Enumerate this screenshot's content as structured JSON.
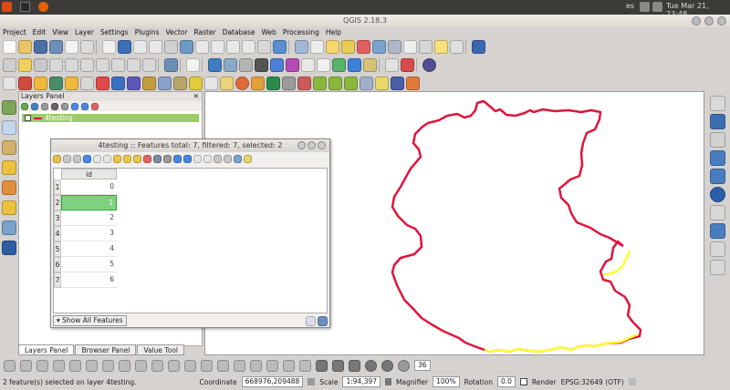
{
  "topbar": {
    "time": "Tue Mar 21, 23:48",
    "lang": "es"
  },
  "window": {
    "title": "QGIS 2.18.3"
  },
  "menu": [
    "Project",
    "Edit",
    "View",
    "Layer",
    "Settings",
    "Plugins",
    "Vector",
    "Raster",
    "Database",
    "Web",
    "Processing",
    "Help"
  ],
  "layers_panel": {
    "title": "Layers Panel",
    "layer_name": "4testing"
  },
  "panel_tabs": [
    "Layers Panel",
    "Browser Panel",
    "Value Tool"
  ],
  "attr_table": {
    "title": "4testing :: Features total: 7, filtered: 7, selected: 2",
    "column": "id",
    "rows": [
      {
        "n": "1",
        "v": "0"
      },
      {
        "n": "2",
        "v": "1"
      },
      {
        "n": "3",
        "v": "2"
      },
      {
        "n": "4",
        "v": "3"
      },
      {
        "n": "5",
        "v": "4"
      },
      {
        "n": "6",
        "v": "5"
      },
      {
        "n": "7",
        "v": "6"
      }
    ],
    "show_all": "Show All Features"
  },
  "nav": {
    "value": "36"
  },
  "status": {
    "message": "2 feature(s) selected on layer 4testing.",
    "coordinate_label": "Coordinate",
    "coordinate": "668976,209488",
    "scale_label": "Scale",
    "scale": "1:94,397",
    "magnifier_label": "Magnifier",
    "magnifier": "100%",
    "rotation_label": "Rotation",
    "rotation": "0.0",
    "render_label": "Render",
    "epsg": "EPSG:32649 (OTF)"
  },
  "colors": {
    "boundary": "#e0143c",
    "selected": "#ffff33",
    "selection_row": "#7ed27f"
  }
}
